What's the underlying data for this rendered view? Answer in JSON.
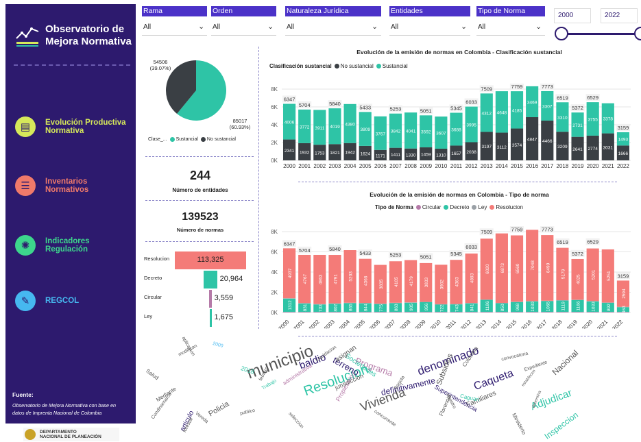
{
  "sidebar": {
    "title_line1": "Observatorio de",
    "title_line2": "Mejora Normativa",
    "nav": [
      {
        "label_line1": "Evolución Productiva",
        "label_line2": "Normativa",
        "color": "#d6e85a",
        "text_color": "#d6e85a",
        "icon": "chart-doc-icon"
      },
      {
        "label_line1": "Inventarios",
        "label_line2": "Normativos",
        "color": "#f07a6a",
        "text_color": "#f07a6a",
        "icon": "inventory-icon"
      },
      {
        "label_line1": "Indicadores",
        "label_line2": "Regulación",
        "color": "#3dd68c",
        "text_color": "#3dd68c",
        "icon": "indicator-icon"
      },
      {
        "label_line1": "REGCOL",
        "label_line2": "",
        "color": "#46b8f0",
        "text_color": "#46b8f0",
        "icon": "regcol-icon"
      }
    ],
    "source_title": "Fuente:",
    "source_line1": "Observatorio de Mejora Normativa con base en",
    "source_line2": "datos de Imprenta Nacional de Colombia",
    "footer_line1": "DEPARTAMENTO",
    "footer_line2": "NACIONAL DE PLANEACIÓN"
  },
  "filters": [
    {
      "label": "Rama",
      "value": "All"
    },
    {
      "label": "Orden",
      "value": "All"
    },
    {
      "label": "Naturaleza Jurídica",
      "value": "All"
    },
    {
      "label": "Entidades",
      "value": "All"
    },
    {
      "label": "Tipo de Norma",
      "value": "All"
    }
  ],
  "years": {
    "from": "2000",
    "to": "2022"
  },
  "pie": {
    "legend_title": "Clase_...",
    "slices": [
      {
        "name": "Sustancial",
        "value": 85017,
        "pct": "(60.93%)",
        "color": "#2ec4a6"
      },
      {
        "name": "No sustancial",
        "value": 54506,
        "pct": "(39.07%)",
        "color": "#3a3f44"
      }
    ],
    "label_sust": "85017",
    "label_sust_pct": "(60.93%)",
    "label_nosust": "54506",
    "label_nosust_pct": "(39.07%)"
  },
  "cards": {
    "entities_value": "244",
    "entities_label": "Número de entidades",
    "norms_value": "139523",
    "norms_label": "Número de normas"
  },
  "funnel": [
    {
      "label": "Resolucion",
      "value": 113325,
      "display": "113,325",
      "color": "#f47b78"
    },
    {
      "label": "Decreto",
      "value": 20964,
      "display": "20,964",
      "color": "#2ec4a6"
    },
    {
      "label": "Circular",
      "value": 3559,
      "display": "3,559",
      "color": "#b57aa8"
    },
    {
      "label": "Ley",
      "value": 1675,
      "display": "1,675",
      "color": "#2ec4a6"
    }
  ],
  "chart_data": [
    {
      "type": "bar",
      "stacked": true,
      "title": "Evolución de la emisión de normas en Colombia - Clasificación sustancial",
      "legend_title": "Clasificación sustancial",
      "categories": [
        "2000",
        "2001",
        "2002",
        "2003",
        "2004",
        "2005",
        "2006",
        "2007",
        "2008",
        "2009",
        "2010",
        "2011",
        "2012",
        "2013",
        "2014",
        "2015",
        "2016",
        "2017",
        "2018",
        "2019",
        "2020",
        "2021",
        "2022"
      ],
      "series": [
        {
          "name": "No sustancial",
          "color": "#3a3f44",
          "values": [
            2341,
            1932,
            1753,
            1821,
            1942,
            1624,
            1171,
            1411,
            1330,
            1459,
            1310,
            1657,
            2038,
            3197,
            3112,
            3574,
            4847,
            4466,
            3209,
            2641,
            2774,
            3031,
            1666
          ]
        },
        {
          "name": "Sustancial",
          "color": "#2ec4a6",
          "values": [
            4006,
            3772,
            3911,
            4019,
            4380,
            3809,
            3767,
            3842,
            4041,
            3592,
            3607,
            3688,
            3995,
            4312,
            4648,
            4185,
            3469,
            3307,
            3310,
            2731,
            3755,
            3378,
            1493
          ]
        }
      ],
      "totals": [
        6347,
        5704,
        5664,
        5840,
        6322,
        5433,
        4938,
        5253,
        5371,
        5051,
        4917,
        5345,
        6033,
        7509,
        7760,
        7759,
        8316,
        7773,
        6519,
        5372,
        6529,
        6409,
        3159
      ],
      "total_labels": [
        "6347",
        "5704",
        "",
        "5840",
        "",
        "5433",
        "",
        "5253",
        "",
        "5051",
        "",
        "5345",
        "6033",
        "7509",
        "",
        "7759",
        "",
        "7773",
        "6519",
        "5372",
        "6529",
        "",
        "3159"
      ],
      "ylim": [
        0,
        8000
      ],
      "yticks": [
        "0K",
        "2K",
        "4K",
        "6K",
        "8K"
      ]
    },
    {
      "type": "bar",
      "stacked": true,
      "title": "Evolución de la emisión de normas en Colombia - Tipo de norma",
      "legend_title": "Tipo de Norma",
      "categories": [
        "2000",
        "2001",
        "2002",
        "2003",
        "2004",
        "2005",
        "2006",
        "2007",
        "2008",
        "2009",
        "2010",
        "2011",
        "2012",
        "2013",
        "2014",
        "2015",
        "2016",
        "2017",
        "2018",
        "2019",
        "2020",
        "2021",
        "2022"
      ],
      "series": [
        {
          "name": "Circular",
          "color": "#b57aa8",
          "values": [
            60,
            60,
            60,
            60,
            60,
            60,
            60,
            60,
            60,
            60,
            60,
            60,
            60,
            60,
            60,
            60,
            60,
            60,
            60,
            60,
            60,
            60,
            60
          ]
        },
        {
          "name": "Decreto",
          "color": "#2ec4a6",
          "values": [
            1312,
            831,
            733,
            802,
            865,
            844,
            775,
            863,
            905,
            956,
            722,
            743,
            841,
            1186,
            850,
            968,
            1030,
            1065,
            1119,
            1166,
            1033,
            892,
            463
          ]
        },
        {
          "name": "Ley",
          "color": "#9aa0a6",
          "values": [
            40,
            40,
            40,
            40,
            40,
            40,
            40,
            40,
            40,
            40,
            40,
            40,
            40,
            40,
            40,
            40,
            40,
            40,
            40,
            40,
            40,
            40,
            40
          ]
        },
        {
          "name": "Resolucion",
          "color": "#f47b78",
          "values": [
            4937,
            4767,
            4863,
            4791,
            5203,
            4366,
            3835,
            4105,
            4179,
            3833,
            3902,
            4363,
            4893,
            6020,
            6873,
            6560,
            7048,
            6490,
            5179,
            4025,
            5201,
            5251,
            2594
          ]
        }
      ],
      "totals": [
        6347,
        5704,
        5696,
        5840,
        6168,
        5433,
        4710,
        5253,
        5184,
        5051,
        4724,
        5345,
        6033,
        7509,
        7823,
        7759,
        8178,
        7773,
        6519,
        5372,
        6529,
        6343,
        3159
      ],
      "total_labels": [
        "6347",
        "5704",
        "",
        "5840",
        "",
        "5433",
        "",
        "5253",
        "",
        "5051",
        "",
        "5345",
        "6033",
        "7509",
        "",
        "7759",
        "",
        "7773",
        "6519",
        "5372",
        "6529",
        "",
        "3159"
      ],
      "ylim": [
        0,
        8000
      ],
      "yticks": [
        "0K",
        "2K",
        "4K",
        "6K",
        "8K"
      ]
    }
  ],
  "wordcloud": {
    "words": [
      {
        "t": "municipio",
        "s": 24,
        "c": "#555"
      },
      {
        "t": "Resolucion",
        "s": 20,
        "c": "#2ec4a6"
      },
      {
        "t": "Vivienda",
        "s": 18,
        "c": "#555"
      },
      {
        "t": "denominado",
        "s": 17,
        "c": "#2d1a6e"
      },
      {
        "t": "Caqueta",
        "s": 16,
        "c": "#2d1a6e"
      },
      {
        "t": "Adjudicar",
        "s": 15,
        "c": "#2ec4a6"
      },
      {
        "t": "baldio",
        "s": 15,
        "c": "#2d1a6e"
      },
      {
        "t": "Programa",
        "s": 13,
        "c": "#b57aa8"
      },
      {
        "t": "definitivamente",
        "s": 12,
        "c": "#2d1a6e"
      },
      {
        "t": "Inspeccion",
        "s": 12,
        "c": "#2ec4a6"
      },
      {
        "t": "Nacional",
        "s": 12,
        "c": "#555"
      },
      {
        "t": "Subsidios",
        "s": 11,
        "c": "#555"
      },
      {
        "t": "terreno",
        "s": 13,
        "c": "#2d1a6e"
      },
      {
        "t": "Policia",
        "s": 11,
        "c": "#555"
      },
      {
        "t": "articulo",
        "s": 10,
        "c": "#2d1a6e"
      },
      {
        "t": "Sociedades",
        "s": 10,
        "c": "#2ec4a6"
      },
      {
        "t": "Familiares",
        "s": 10,
        "c": "#555"
      },
      {
        "t": "asignan",
        "s": 10,
        "c": "#555"
      },
      {
        "t": "Superintendencia",
        "s": 9,
        "c": "#2d1a6e"
      },
      {
        "t": "Propietarios",
        "s": 9,
        "c": "#b57aa8"
      },
      {
        "t": "jurisdiccion",
        "s": 9,
        "c": "#555"
      },
      {
        "t": "Colombia",
        "s": 8,
        "c": "#555"
      },
      {
        "t": "Ministerio",
        "s": 8,
        "c": "#555"
      },
      {
        "t": "Caguan",
        "s": 8,
        "c": "#2ec4a6"
      },
      {
        "t": "administrativa",
        "s": 8,
        "c": "#b57aa8"
      },
      {
        "t": "Florencia",
        "s": 8,
        "c": "#555"
      },
      {
        "t": "Salud",
        "s": 8,
        "c": "#555"
      },
      {
        "t": "forestal",
        "s": 7,
        "c": "#555"
      },
      {
        "t": "Bogota",
        "s": 7,
        "c": "#555"
      },
      {
        "t": "Expediente",
        "s": 7,
        "c": "#555"
      },
      {
        "t": "registro",
        "s": 7,
        "c": "#555"
      },
      {
        "t": "publico",
        "s": 7,
        "c": "#555"
      },
      {
        "t": "aplicacion",
        "s": 7,
        "c": "#555"
      },
      {
        "t": "convocatoria",
        "s": 7,
        "c": "#555"
      },
      {
        "t": "Trabajo",
        "s": 7,
        "c": "#2ec4a6"
      },
      {
        "t": "2018",
        "s": 9,
        "c": "#2ec4a6"
      },
      {
        "t": "2000",
        "s": 7,
        "c": "#46b8f0"
      },
      {
        "t": "Liquidacion",
        "s": 7,
        "c": "#555"
      },
      {
        "t": "Cundinamarca",
        "s": 7,
        "c": "#555"
      },
      {
        "t": "seleccion",
        "s": 7,
        "c": "#555"
      },
      {
        "t": "febrero",
        "s": 7,
        "c": "#555"
      },
      {
        "t": "modifican",
        "s": 7,
        "c": "#555"
      },
      {
        "t": "Mediante",
        "s": 8,
        "c": "#555"
      },
      {
        "t": "concurrente",
        "s": 7,
        "c": "#555"
      },
      {
        "t": "Vereda",
        "s": 7,
        "c": "#555"
      },
      {
        "t": "determina",
        "s": 6,
        "c": "#555"
      },
      {
        "t": "establecen",
        "s": 6,
        "c": "#555"
      }
    ]
  }
}
